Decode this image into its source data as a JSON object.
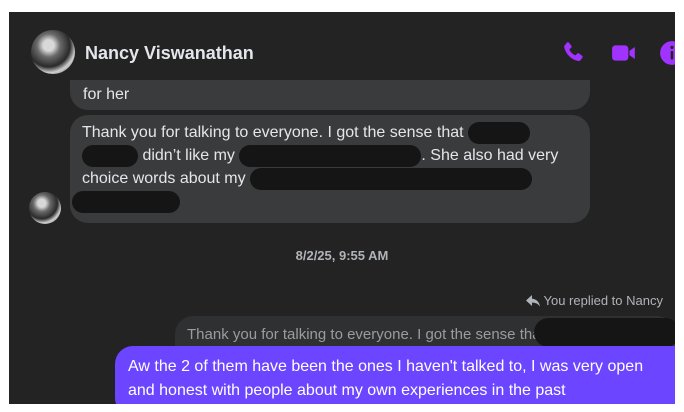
{
  "header": {
    "contact_name": "Nancy Viswanathan",
    "icons": [
      "phone-icon",
      "video-camera-icon",
      "info-icon"
    ],
    "accent_color": "#a033ff"
  },
  "messages": {
    "prev_tail": "for her",
    "incoming": {
      "part1": "Thank you for talking to everyone. I got the sense that",
      "part2": "didn’t like my",
      "part3": ". She also had very",
      "part4": "choice words about my"
    },
    "timestamp": "8/2/25, 9:55 AM",
    "reply_note": "You replied to Nancy",
    "quoted_text": "Thank you for talking to everyone. I got the sense that",
    "outgoing_text": "Aw the 2 of them have been the ones I haven't talked to, I was very open and honest with people about my own experiences in the past"
  },
  "colors": {
    "background": "#232323",
    "incoming_bubble": "#3a3b3c",
    "outgoing_bubble": "#6b45ff",
    "redaction": "#151515"
  }
}
